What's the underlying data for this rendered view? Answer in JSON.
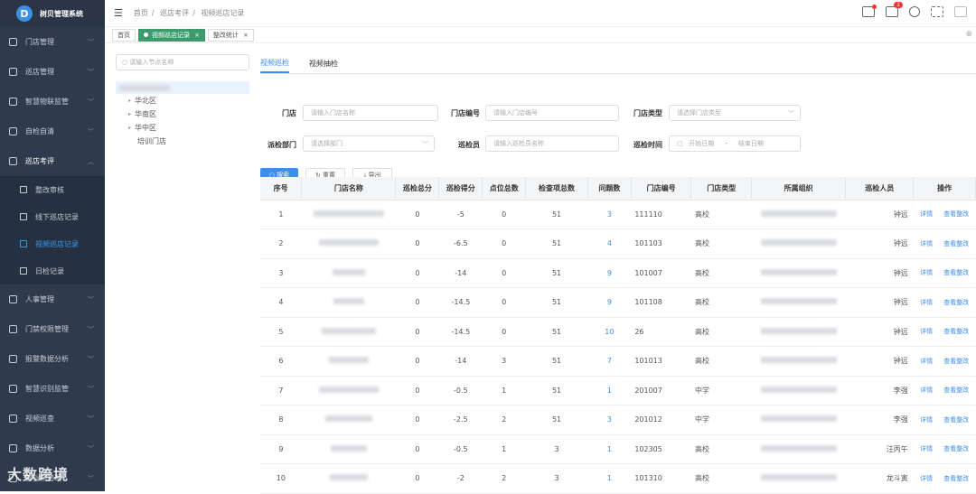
{
  "app": {
    "title": "树贝管理系统",
    "logo_char": "D"
  },
  "sidebar": {
    "items": [
      {
        "label": "门店管理",
        "icon": "store-icon"
      },
      {
        "label": "巡店管理",
        "icon": "grid-icon"
      },
      {
        "label": "智慧物联监管",
        "icon": "iot-icon"
      },
      {
        "label": "自检自清",
        "icon": "check-icon"
      },
      {
        "label": "巡店考评",
        "icon": "eval-icon"
      }
    ],
    "sub_items": [
      {
        "label": "整改审核",
        "icon": "grid-icon"
      },
      {
        "label": "线下巡店记录",
        "icon": "pin-icon"
      },
      {
        "label": "视频巡店记录",
        "icon": "video-icon",
        "active": true
      },
      {
        "label": "日检记录",
        "icon": "doc-icon"
      }
    ],
    "items_after": [
      {
        "label": "人事管理",
        "icon": "user-icon"
      },
      {
        "label": "门禁权限管理",
        "icon": "door-icon"
      },
      {
        "label": "报警数据分析",
        "icon": "alarm-icon"
      },
      {
        "label": "智慧识别监管",
        "icon": "eye-icon"
      },
      {
        "label": "视频巡查",
        "icon": "camera-icon"
      },
      {
        "label": "数据分析",
        "icon": "chart-icon"
      },
      {
        "label": "营业档管理",
        "icon": "file-icon"
      }
    ],
    "watermark": "大数跨境"
  },
  "topbar": {
    "breadcrumb": [
      "首页",
      "巡店考评",
      "视频巡店记录"
    ],
    "notification_count": "1"
  },
  "tabs": [
    {
      "label": "首页"
    },
    {
      "label": "视频巡店记录",
      "active": true
    },
    {
      "label": "整改统计"
    }
  ],
  "tree": {
    "search_placeholder": "请输入节点名称",
    "nodes": [
      "华北区",
      "华南区",
      "华中区",
      "培训门店"
    ]
  },
  "page_tabs": [
    "视频巡检",
    "视频抽检"
  ],
  "form": {
    "store_label": "门店",
    "store_placeholder": "请输入门店名称",
    "store_no_label": "门店编号",
    "store_no_placeholder": "请输入门店编号",
    "store_type_label": "门店类型",
    "store_type_placeholder": "请选择门店类型",
    "dept_label": "派检部门",
    "dept_placeholder": "请选择部门",
    "inspector_label": "巡检员",
    "inspector_placeholder": "请输入巡检员名称",
    "time_label": "巡检时间",
    "start_placeholder": "开始日期",
    "range_sep": "-",
    "end_placeholder": "结束日期",
    "search_btn": "搜索",
    "reset_btn": "重置",
    "export_btn": "导出"
  },
  "table": {
    "headers": [
      "序号",
      "门店名称",
      "巡检总分",
      "巡检得分",
      "点位总数",
      "检查项总数",
      "问题数",
      "门店编号",
      "门店类型",
      "所属组织",
      "巡检人员",
      "操作"
    ],
    "op_detail": "详情",
    "op_fix": "查看整改",
    "rows": [
      {
        "no": "1",
        "total": "0",
        "score": "-5",
        "points": "0",
        "items": "51",
        "issues": "3",
        "code": "111110",
        "type": "高校",
        "person": "钟远"
      },
      {
        "no": "2",
        "total": "0",
        "score": "-6.5",
        "points": "0",
        "items": "51",
        "issues": "4",
        "code": "101103",
        "type": "高校",
        "person": "钟远"
      },
      {
        "no": "3",
        "total": "0",
        "score": "-14",
        "points": "0",
        "items": "51",
        "issues": "9",
        "code": "101007",
        "type": "高校",
        "person": "钟远"
      },
      {
        "no": "4",
        "total": "0",
        "score": "-14.5",
        "points": "0",
        "items": "51",
        "issues": "9",
        "code": "101108",
        "type": "高校",
        "person": "钟远"
      },
      {
        "no": "5",
        "total": "0",
        "score": "-14.5",
        "points": "0",
        "items": "51",
        "issues": "10",
        "code": "26",
        "type": "高校",
        "person": "钟远"
      },
      {
        "no": "6",
        "total": "0",
        "score": "-14",
        "points": "3",
        "items": "51",
        "issues": "7",
        "code": "101013",
        "type": "高校",
        "person": "钟远"
      },
      {
        "no": "7",
        "total": "0",
        "score": "-0.5",
        "points": "1",
        "items": "51",
        "issues": "1",
        "code": "201007",
        "type": "中学",
        "person": "李强"
      },
      {
        "no": "8",
        "total": "0",
        "score": "-2.5",
        "points": "2",
        "items": "51",
        "issues": "3",
        "code": "201012",
        "type": "中学",
        "person": "李强"
      },
      {
        "no": "9",
        "total": "0",
        "score": "-0.5",
        "points": "1",
        "items": "3",
        "issues": "1",
        "code": "102305",
        "type": "高校",
        "person": "汪丙午"
      },
      {
        "no": "10",
        "total": "0",
        "score": "-2",
        "points": "2",
        "items": "3",
        "issues": "1",
        "code": "101310",
        "type": "高校",
        "person": "龙斗寅"
      }
    ]
  }
}
